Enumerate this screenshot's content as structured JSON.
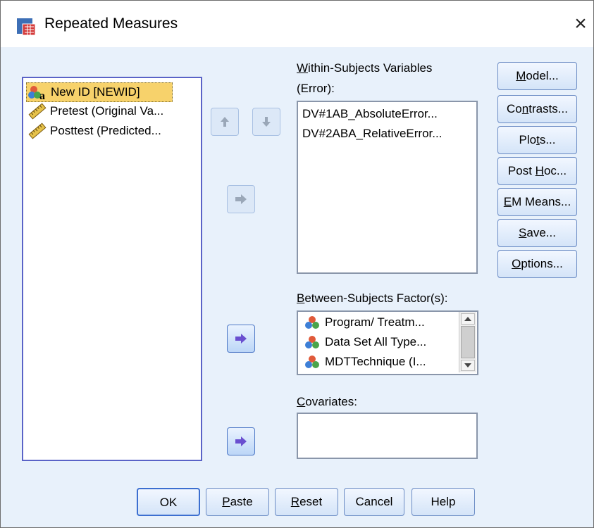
{
  "window": {
    "title": "Repeated Measures"
  },
  "variables_list": [
    {
      "label": "New ID [NEWID]",
      "icon": "nominal-variable-icon",
      "selected": true
    },
    {
      "label": "Pretest (Original Va...",
      "icon": "scale-ruler-icon",
      "selected": false
    },
    {
      "label": "Posttest (Predicted...",
      "icon": "scale-ruler-icon",
      "selected": false
    }
  ],
  "within": {
    "label_line1": "Within-Subjects Variables",
    "label_line2": "(Error):",
    "items": [
      "DV#1AB_AbsoluteError...",
      "DV#2ABA_RelativeError..."
    ]
  },
  "between": {
    "label": "Between-Subjects Factor(s):",
    "items": [
      "Program/ Treatm...",
      "Data Set All Type...",
      "MDTTechnique (I..."
    ]
  },
  "covariates": {
    "label": "Covariates:"
  },
  "right_buttons": [
    "Model...",
    "Contrasts...",
    "Plots...",
    "Post Hoc...",
    "EM Means...",
    "Save...",
    "Options..."
  ],
  "bottom_buttons": [
    "OK",
    "Paste",
    "Reset",
    "Cancel",
    "Help"
  ],
  "colors": {
    "accent": "#5a63c7",
    "selection": "#f7d26b",
    "background": "#e8f1fb"
  }
}
